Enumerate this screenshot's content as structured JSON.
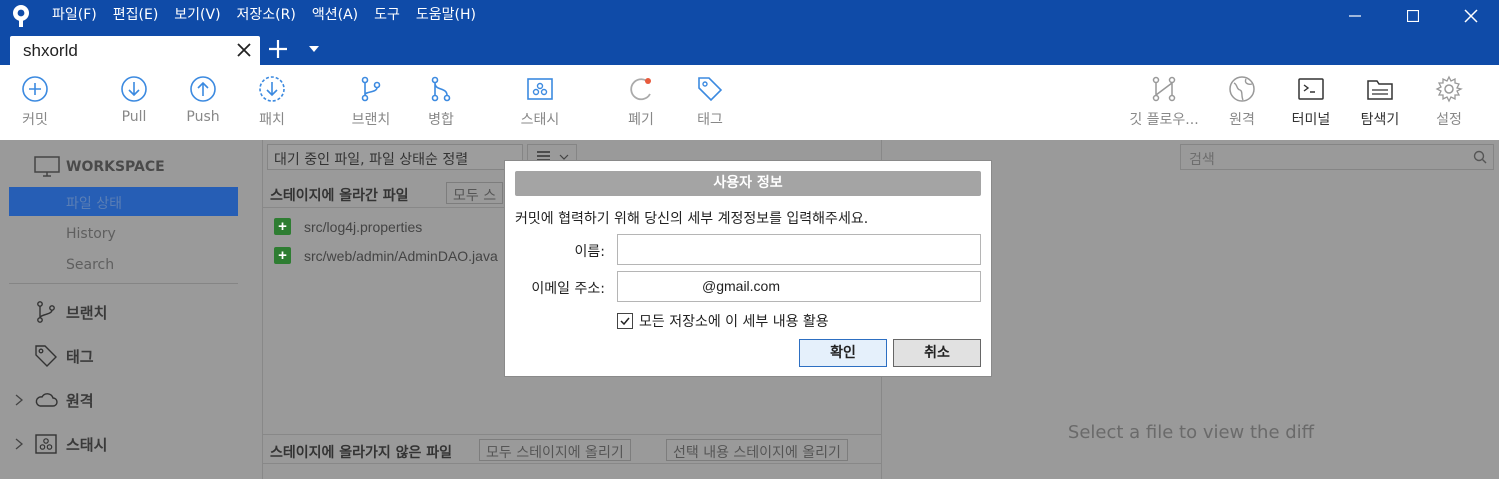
{
  "menu": [
    "파일(F)",
    "편집(E)",
    "보기(V)",
    "저장소(R)",
    "액션(A)",
    "도구",
    "도움말(H)"
  ],
  "tab": {
    "title": "shxorld"
  },
  "toolbar": {
    "commit": "커밋",
    "pull": "Pull",
    "push": "Push",
    "patch": "패치",
    "branch": "브랜치",
    "merge": "병합",
    "stash": "스태시",
    "discard": "폐기",
    "tag": "태그",
    "gitflow": "깃 플로우...",
    "remote": "원격",
    "terminal": "터미널",
    "explorer": "탐색기",
    "settings": "설정"
  },
  "sidebar": {
    "workspace": "WORKSPACE",
    "items": [
      "파일 상태",
      "History",
      "Search"
    ],
    "groups": [
      "브랜치",
      "태그",
      "원격",
      "스태시"
    ]
  },
  "center": {
    "filter": "대기 중인 파일, 파일 상태순 정렬",
    "staged_title": "스테이지에 올라간 파일",
    "staged_btn": "모두 스",
    "staged_files": [
      "src/log4j.properties",
      "src/web/admin/AdminDAO.java"
    ],
    "unstaged_title": "스테이지에 올라가지 않은 파일",
    "stage_all": "모두 스테이지에 올리기",
    "stage_selected": "선택 내용 스테이지에 올리기"
  },
  "right": {
    "search_placeholder": "검색",
    "diff_hint": "Select a file to view the diff"
  },
  "dialog": {
    "title": "사용자 정보",
    "message": "커밋에 협력하기 위해 당신의 세부 계정정보를 입력해주세요.",
    "name_label": "이름:",
    "name_value": "",
    "email_label": "이메일 주소:",
    "email_value": "@gmail.com",
    "checkbox_label": "모든 저장소에 이 세부 내용 활용",
    "checkbox_checked": true,
    "ok": "확인",
    "cancel": "취소"
  }
}
